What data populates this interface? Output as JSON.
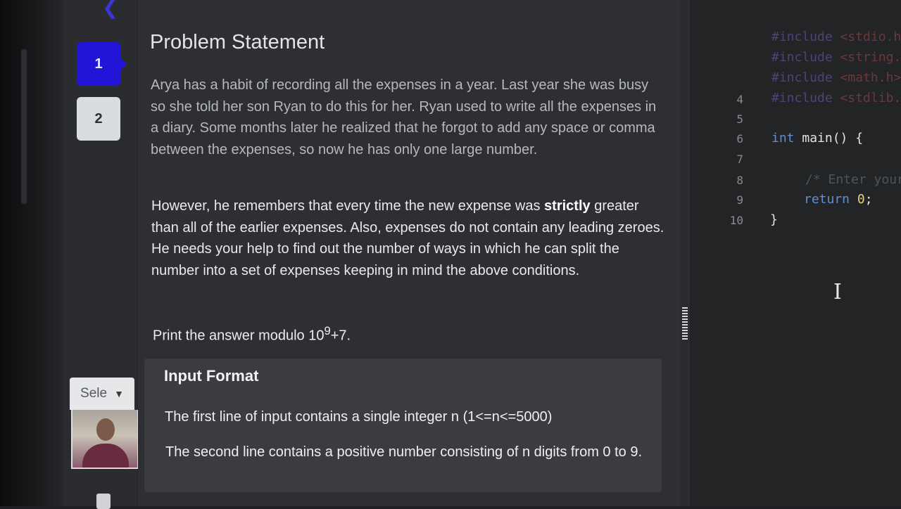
{
  "sidebar": {
    "questions": [
      {
        "label": "1",
        "active": true
      },
      {
        "label": "2",
        "active": false
      }
    ],
    "language_select": {
      "value": "Sele"
    },
    "icons": {
      "back": "back-arrow-icon",
      "clipboard": "clipboard-icon",
      "chevron": "chevron-down-icon"
    }
  },
  "problem": {
    "title": "Problem Statement",
    "paragraph1": "Arya has a habit of recording all the expenses in a year. Last year she was busy so she told her son Ryan to do this for her. Ryan used to write all the expenses in a diary. Some months later he realized that he forgot to add any space or comma between the expenses, so now he has only one large number.",
    "paragraph2_before": "However, he remembers that every time the new expense was ",
    "paragraph2_bold": "strictly",
    "paragraph2_after": " greater than all of the earlier expenses. Also, expenses do not contain any leading zeroes. He needs your help to find out the number of ways in which he can split the number into a set of expenses keeping in mind the above conditions.",
    "print_text": "Print the answer modulo 10",
    "print_exp": "9",
    "print_tail": "+7."
  },
  "input_format": {
    "title": "Input Format",
    "line1": "The first line of input contains a single integer n (1<=n<=5000)",
    "line2": "The second line contains a positive number consisting of n digits from 0 to 9."
  },
  "editor": {
    "lines": [
      {
        "n": "",
        "inc": "#include",
        "hdr": "<stdio.h>"
      },
      {
        "n": "",
        "inc": "#include",
        "hdr": "<string.h>"
      },
      {
        "n": "",
        "inc": "#include",
        "hdr": "<math.h>"
      },
      {
        "n": "4",
        "inc": "#include",
        "hdr": "<stdlib.h>"
      },
      {
        "n": "5"
      },
      {
        "n": "6",
        "kw": "int",
        "rest": " main() {"
      },
      {
        "n": "7"
      },
      {
        "n": "8",
        "comment": "/* Enter your"
      },
      {
        "n": "9",
        "kw": "return",
        "num": "0",
        "rest": ";"
      },
      {
        "n": "10",
        "rest": "}"
      }
    ]
  },
  "theme": {
    "accent": "#2315d8",
    "panel_bg": "#2d2f33",
    "editor_bg": "#222426"
  }
}
